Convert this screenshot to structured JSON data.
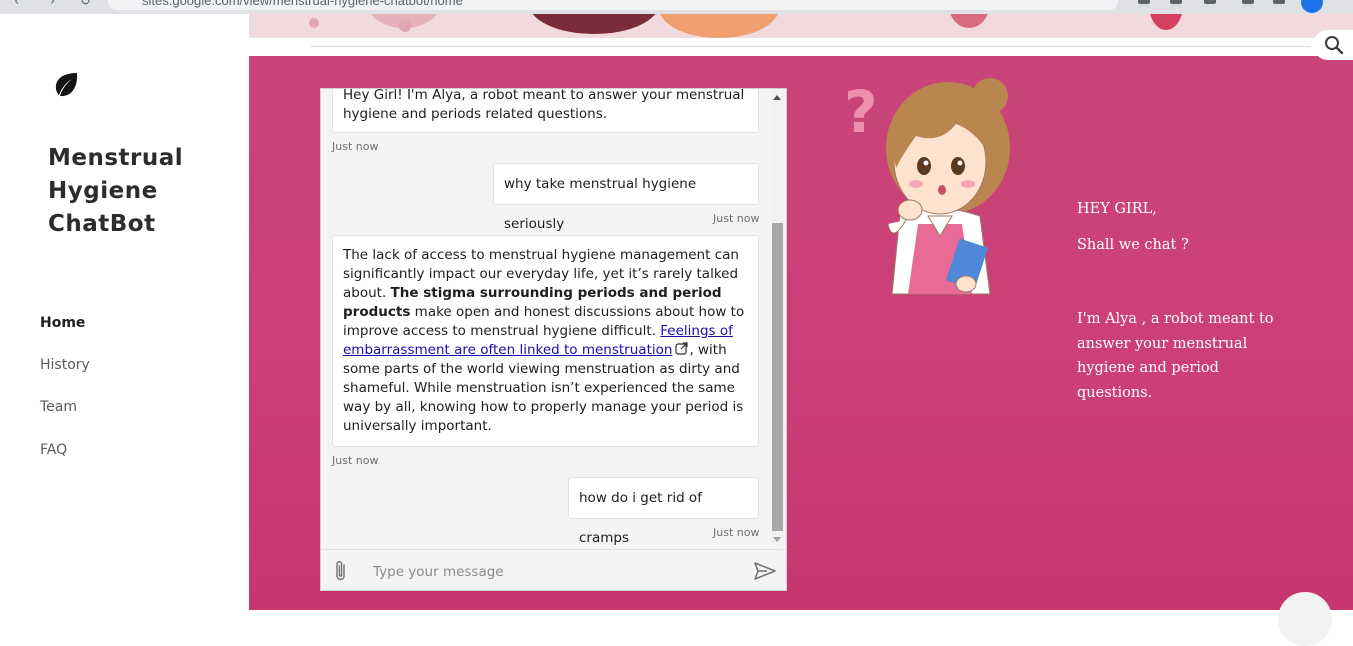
{
  "browser": {
    "url": "sites.google.com/view/menstrual-hygiene-chatbot/home"
  },
  "site": {
    "title": "Menstrual Hygiene ChatBot",
    "logo_icon": "leaf-icon"
  },
  "nav": {
    "items": [
      {
        "label": "Home",
        "active": true
      },
      {
        "label": "History",
        "active": false
      },
      {
        "label": "Team",
        "active": false
      },
      {
        "label": "FAQ",
        "active": false
      }
    ]
  },
  "colors": {
    "main_bg": "#c84679",
    "link": "#1a0dab"
  },
  "chat": {
    "messages": [
      {
        "from": "bot",
        "text": "Hey Girl! I'm Alya, a robot meant to answer your menstrual hygiene and periods related questions.",
        "time": "Just now"
      },
      {
        "from": "user",
        "text": "why take menstrual hygiene seriously",
        "time": "Just now"
      },
      {
        "from": "bot",
        "part1": "The lack of access to menstrual hygiene management can significantly impact our everyday life, yet it’s rarely talked about. ",
        "bold": "The stigma surrounding periods and period products",
        "part2": " make open and honest discussions about how to improve access to menstrual hygiene difficult. ",
        "link": "Feelings of embarrassment are often linked to menstruation",
        "part3": ", with some parts of the world viewing menstruation as dirty and shameful. While menstruation isn’t experienced the same way by all, knowing how to properly manage your period is universally important.",
        "time": "Just now"
      },
      {
        "from": "user",
        "text": "how do i get rid of cramps",
        "time": "Just now"
      }
    ],
    "input_placeholder": "Type your message"
  },
  "aside": {
    "greeting": "HEY GIRL,",
    "prompt": "Shall we chat ?",
    "intro": "I'm Alya , a robot meant to answer your menstrual hygiene and  period questions."
  }
}
